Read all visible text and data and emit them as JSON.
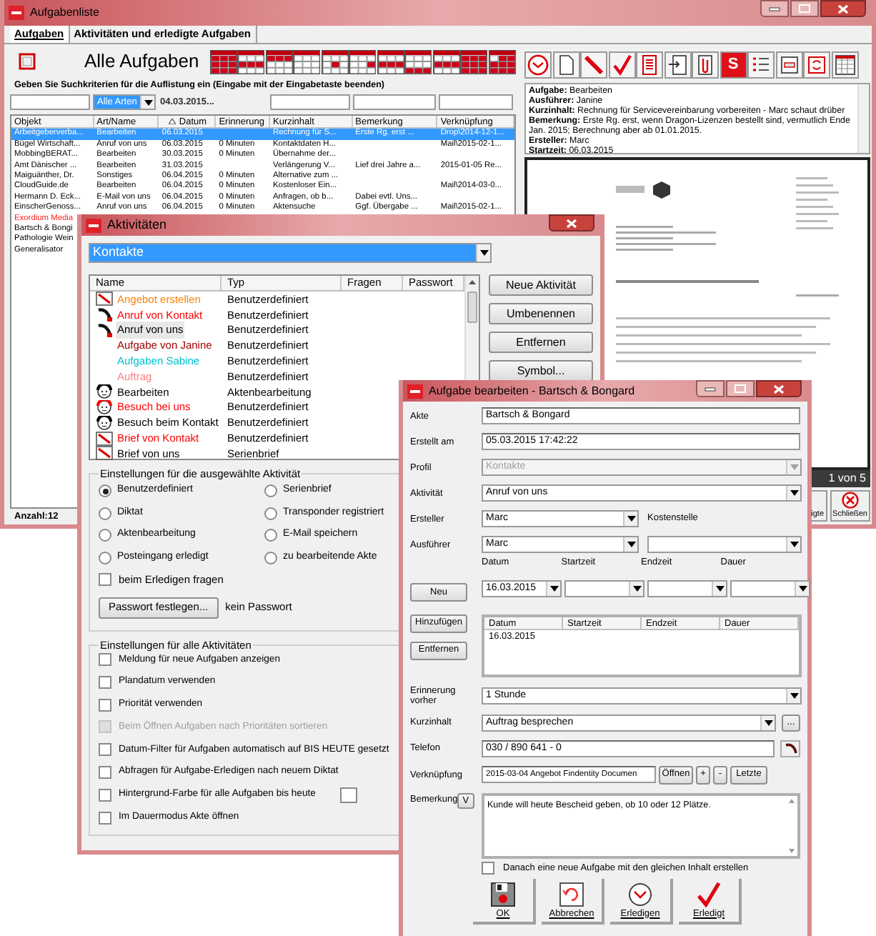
{
  "main_window": {
    "title": "Aufgabenliste",
    "tabs": [
      {
        "label": "Aufgaben",
        "selected": true
      },
      {
        "label": "Aktivitäten und erledigte Aufgaben",
        "selected": false
      }
    ],
    "view_title": "Alle Aufgaben",
    "search_hint": "Geben Sie Suchkriterien für die Auflistung ein (Eingabe mit der Eingabetaste beenden)",
    "filters": {
      "type": "Alle Arten",
      "date": "04.03.2015..."
    },
    "table": {
      "columns": [
        {
          "label": "Objekt",
          "sorted": false
        },
        {
          "label": "Art/Name",
          "sorted": false
        },
        {
          "label": "Datum",
          "sorted": true
        },
        {
          "label": "Erinnerung",
          "sorted": false
        },
        {
          "label": "Kurzinhalt",
          "sorted": false
        },
        {
          "label": "Bemerkung",
          "sorted": false
        },
        {
          "label": "Verknüpfung",
          "sorted": false
        }
      ],
      "rows": [
        {
          "selected": true,
          "cells": {
            "column_1": "Arbeitgeberverba...",
            "column_2": "Bearbeiten",
            "column_3": "06.03.2015",
            "column_5": "Rechnung für S...",
            "column_6": "Erste Rg. erst ...",
            "column_7": "Drop\\2014-12-1..."
          }
        },
        {
          "selected": false,
          "cells": {
            "column_1": "Bügel Wirtschaft...",
            "column_2": "Anruf von uns",
            "column_3": "06.03.2015",
            "column_4": "0 Minuten",
            "column_5": "Kontaktdaten H...",
            "column_7": "Mail\\2015-02-1..."
          }
        },
        {
          "selected": false,
          "cells": {
            "column_1": "MobbingBERAT...",
            "column_2": "Bearbeiten",
            "column_3": "30.03.2015",
            "column_4": "0 Minuten",
            "column_5": "Übernahme der..."
          }
        },
        {
          "selected": false,
          "cells": {
            "column_1": "Amt Dänischer ...",
            "column_2": "Bearbeiten",
            "column_3": "31.03.2015",
            "column_5": "Verlängerung V...",
            "column_6": "Lief drei Jahre a...",
            "column_7": "2015-01-05 Re..."
          }
        },
        {
          "selected": false,
          "cells": {
            "column_1": "Maiguänther, Dr.",
            "column_2": "Sonstiges",
            "column_3": "06.04.2015",
            "column_4": "0 Minuten",
            "column_5": "Alternative zum ..."
          }
        },
        {
          "selected": false,
          "cells": {
            "column_1": "CloudGuide.de",
            "column_2": "Bearbeiten",
            "column_3": "06.04.2015",
            "column_4": "0 Minuten",
            "column_5": "Kostenloser Ein...",
            "column_7": "Mail\\2014-03-0..."
          }
        },
        {
          "selected": false,
          "cells": {
            "column_1": "Hermann D. Eck...",
            "column_2": "E-Mail von uns",
            "column_3": "06.04.2015",
            "column_4": "0 Minuten",
            "column_5": "Anfragen, ob b...",
            "column_6": "Dabei evtl. Uns..."
          }
        },
        {
          "selected": false,
          "cells": {
            "column_1": "EinscherGenoss...",
            "column_2": "Anruf von uns",
            "column_3": "06.04.2015",
            "column_4": "0 Minuten",
            "column_5": "Aktensuche",
            "column_6": "Ggf. Übergabe ...",
            "column_7": "Mail\\2015-02-1..."
          }
        },
        {
          "selected": false,
          "color": "#ff2020",
          "cells": {
            "column_1": "Exordium Media"
          }
        },
        {
          "selected": false,
          "cells": {
            "column_1": "Bartsch & Bongi"
          }
        },
        {
          "selected": false,
          "cells": {
            "column_1": "Pathologie Wein"
          }
        },
        {
          "selected": false,
          "cells": {
            "column_1": "Generalisator"
          }
        }
      ]
    },
    "count": "Anzahl:12",
    "toolbar_letter": "S",
    "details": [
      "**Aufgabe:** Bearbeiten",
      "**Ausführer:** Janine",
      "**Kurzinhalt:** Rechnung für Servicevereinbarung vorbereiten - Marc schaut drüber",
      "**Bemerkung:** Erste Rg. erst, wenn Dragon-Lizenzen bestellt sind, vermutlich Ende Jan. 2015; Berechnung aber ab 01.01.2015.",
      "**Ersteller:** Marc",
      "**Startzeit:** 06.03.2015"
    ],
    "pager": "1 von 5",
    "buttons": [
      {
        "label": "igte",
        "kind": "plain"
      },
      {
        "label": "Schließen",
        "kind": "close"
      }
    ]
  },
  "activities_window": {
    "title": "Aktivitäten",
    "profile": "Kontakte",
    "columns": [
      "Name",
      "Typ",
      "Fragen",
      "Passwort"
    ],
    "items": [
      {
        "name": "Angebot erstellen",
        "type": "Benutzerdefiniert",
        "kind": "letter",
        "color": "#ff8000",
        "selected": false
      },
      {
        "name": "Anruf von Kontakt",
        "type": "Benutzerdefiniert",
        "kind": "phone",
        "color": "#ff0000",
        "selected": false
      },
      {
        "name": "Anruf von uns",
        "type": "Benutzerdefiniert",
        "kind": "phone",
        "color": "#000000",
        "selected": true
      },
      {
        "name": "Aufgabe von Janine",
        "type": "Benutzerdefiniert",
        "kind": "none",
        "color": "#a00000",
        "selected": false
      },
      {
        "name": "Aufgaben Sabine",
        "type": "Benutzerdefiniert",
        "kind": "none",
        "color": "#00c0d0",
        "selected": false
      },
      {
        "name": "Auftrag",
        "type": "Benutzerdefiniert",
        "kind": "none",
        "color": "#ff8080",
        "selected": false
      },
      {
        "name": "Bearbeiten",
        "type": "Aktenbearbeitung",
        "kind": "face",
        "color": "#000000",
        "selected": false
      },
      {
        "name": "Besuch bei uns",
        "type": "Benutzerdefiniert",
        "kind": "face",
        "color": "#ff0000",
        "selected": false
      },
      {
        "name": "Besuch beim Kontakt",
        "type": "Benutzerdefiniert",
        "kind": "face",
        "color": "#000000",
        "selected": false
      },
      {
        "name": "Brief von Kontakt",
        "type": "Benutzerdefiniert",
        "kind": "letter",
        "color": "#ff0000",
        "selected": false
      },
      {
        "name": "Brief von uns",
        "type": "Serienbrief",
        "kind": "letter",
        "color": "#000000",
        "selected": false
      }
    ],
    "buttons": [
      "Neue Aktivität",
      "Umbenennen",
      "Entfernen",
      "Symbol..."
    ],
    "selected_group": {
      "title": "Einstellungen für die ausgewählte Aktivität",
      "options": [
        {
          "label": "Benutzerdefiniert",
          "selected": true
        },
        {
          "label": "Serienbrief",
          "selected": false
        },
        {
          "label": "Diktat",
          "selected": false
        },
        {
          "label": "Transponder registriert",
          "selected": false
        },
        {
          "label": "Aktenbearbeitung",
          "selected": false
        },
        {
          "label": "E-Mail speichern",
          "selected": false
        },
        {
          "label": "Posteingang erledigt",
          "selected": false
        },
        {
          "label": "zu bearbeitende Akte",
          "selected": false
        }
      ],
      "ask_on_done": {
        "label": "beim Erledigen fragen",
        "checked": false
      },
      "password_button": "Passwort festlegen...",
      "password_status": "kein Passwort"
    },
    "all_group": {
      "title": "Einstellungen für alle Aktivitäten",
      "options": [
        {
          "label": "Meldung für neue Aufgaben anzeigen",
          "checked": false,
          "disabled": false,
          "kind": "plain"
        },
        {
          "label": "Plandatum verwenden",
          "checked": false,
          "disabled": false,
          "kind": "plain"
        },
        {
          "label": "Priorität verwenden",
          "checked": false,
          "disabled": false,
          "kind": "plain"
        },
        {
          "label": "Beim Öffnen Aufgaben nach Prioritäten sortieren",
          "checked": false,
          "disabled": true,
          "kind": "plain"
        },
        {
          "label": "Datum-Filter für Aufgaben automatisch auf BIS HEUTE gesetzt",
          "checked": false,
          "disabled": false,
          "kind": "plain"
        },
        {
          "label": "Abfragen für Aufgabe-Erledigen nach neuem Diktat",
          "checked": false,
          "disabled": false,
          "kind": "plain"
        },
        {
          "label": "Hintergrund-Farbe für alle Aufgaben bis heute",
          "checked": false,
          "disabled": false,
          "kind": "swatch"
        },
        {
          "label": "Im Dauermodus Akte öffnen",
          "checked": false,
          "disabled": false,
          "kind": "plain"
        }
      ]
    }
  },
  "edit_dialog": {
    "title": "Aufgabe bearbeiten - Bartsch & Bongard",
    "fields": [
      {
        "label": "Akte",
        "kind": "text",
        "value": "Bartsch & Bongard",
        "disabled": false
      },
      {
        "label": "Erstellt am",
        "kind": "text",
        "value": "05.03.2015 17:42:22",
        "disabled": false
      },
      {
        "label": "Profil",
        "kind": "select",
        "value": "Kontakte",
        "disabled": true
      },
      {
        "label": "Aktivität",
        "kind": "select",
        "value": "Anruf von uns",
        "disabled": false
      }
    ],
    "people": [
      {
        "label": "Ersteller",
        "value": "Marc"
      },
      {
        "label": "Ausführer",
        "value": "Marc"
      }
    ],
    "cost_center_label": "Kostenstelle",
    "schedule": {
      "field_labels": [
        "Datum",
        "Startzeit",
        "Endzeit",
        "Dauer"
      ],
      "columns": [
        "Datum",
        "Startzeit",
        "Endzeit",
        "Dauer"
      ],
      "date": "16.03.2015",
      "buttons": [
        "Neu",
        "Hinzufügen",
        "Entfernen"
      ],
      "rows": [
        {
          "column_1": "16.03.2015"
        }
      ]
    },
    "reminder": {
      "label": "Erinnerung vorher",
      "value": "1 Stunde"
    },
    "summary": {
      "label": "Kurzinhalt",
      "value": "Auftrag besprechen",
      "more": "..."
    },
    "phone": {
      "label": "Telefon",
      "value": "030 / 890 641 - 0"
    },
    "link": {
      "label": "Verknüpfung",
      "value": "2015-03-04 Angebot Findentity Documen",
      "buttons": [
        "Öffnen",
        "+",
        "-",
        "Letzte"
      ]
    },
    "remark": {
      "label": "Bemerkung",
      "button": "V",
      "value": "Kunde will heute Bescheid geben, ob 10 oder 12 Plätze."
    },
    "repeat": {
      "label": "Danach eine neue Aufgabe mit den gleichen Inhalt erstellen",
      "checked": false
    },
    "actions": [
      {
        "label": "OK",
        "kind": "save"
      },
      {
        "label": "Abbrechen",
        "kind": "undo"
      },
      {
        "label": "Erledigen",
        "kind": "clock"
      },
      {
        "label": "Erledigt",
        "kind": "check"
      }
    ]
  }
}
